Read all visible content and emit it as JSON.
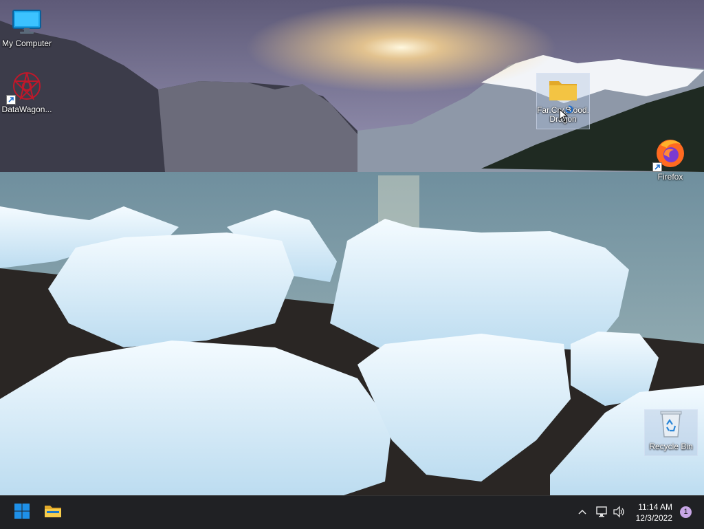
{
  "desktop": {
    "icons": [
      {
        "label": "My Computer",
        "icon": "monitor-icon"
      },
      {
        "label": "DataWagon...",
        "icon": "datawagon-icon",
        "shortcut": true
      },
      {
        "label": "Far.Cry.Blood.Dragon",
        "icon": "folder-icon",
        "selected": true
      },
      {
        "label": "Firefox",
        "icon": "firefox-icon",
        "shortcut": true
      },
      {
        "label": "Recycle Bin",
        "icon": "recycle-bin-icon",
        "selected": true
      }
    ]
  },
  "taskbar": {
    "start_icon": "windows-start-icon",
    "pinned": [
      {
        "icon": "file-explorer-icon"
      }
    ],
    "tray": {
      "chevron_icon": "chevron-up-icon",
      "network_icon": "network-icon",
      "volume_icon": "volume-icon"
    },
    "time": "11:14 AM",
    "date": "12/3/2022",
    "notification_count": "1"
  },
  "colors": {
    "taskbar_bg": "#202124",
    "start_blue": "#1e90e8",
    "folder_yellow": "#f3c443",
    "notification_badge": "#c8a6e6"
  }
}
